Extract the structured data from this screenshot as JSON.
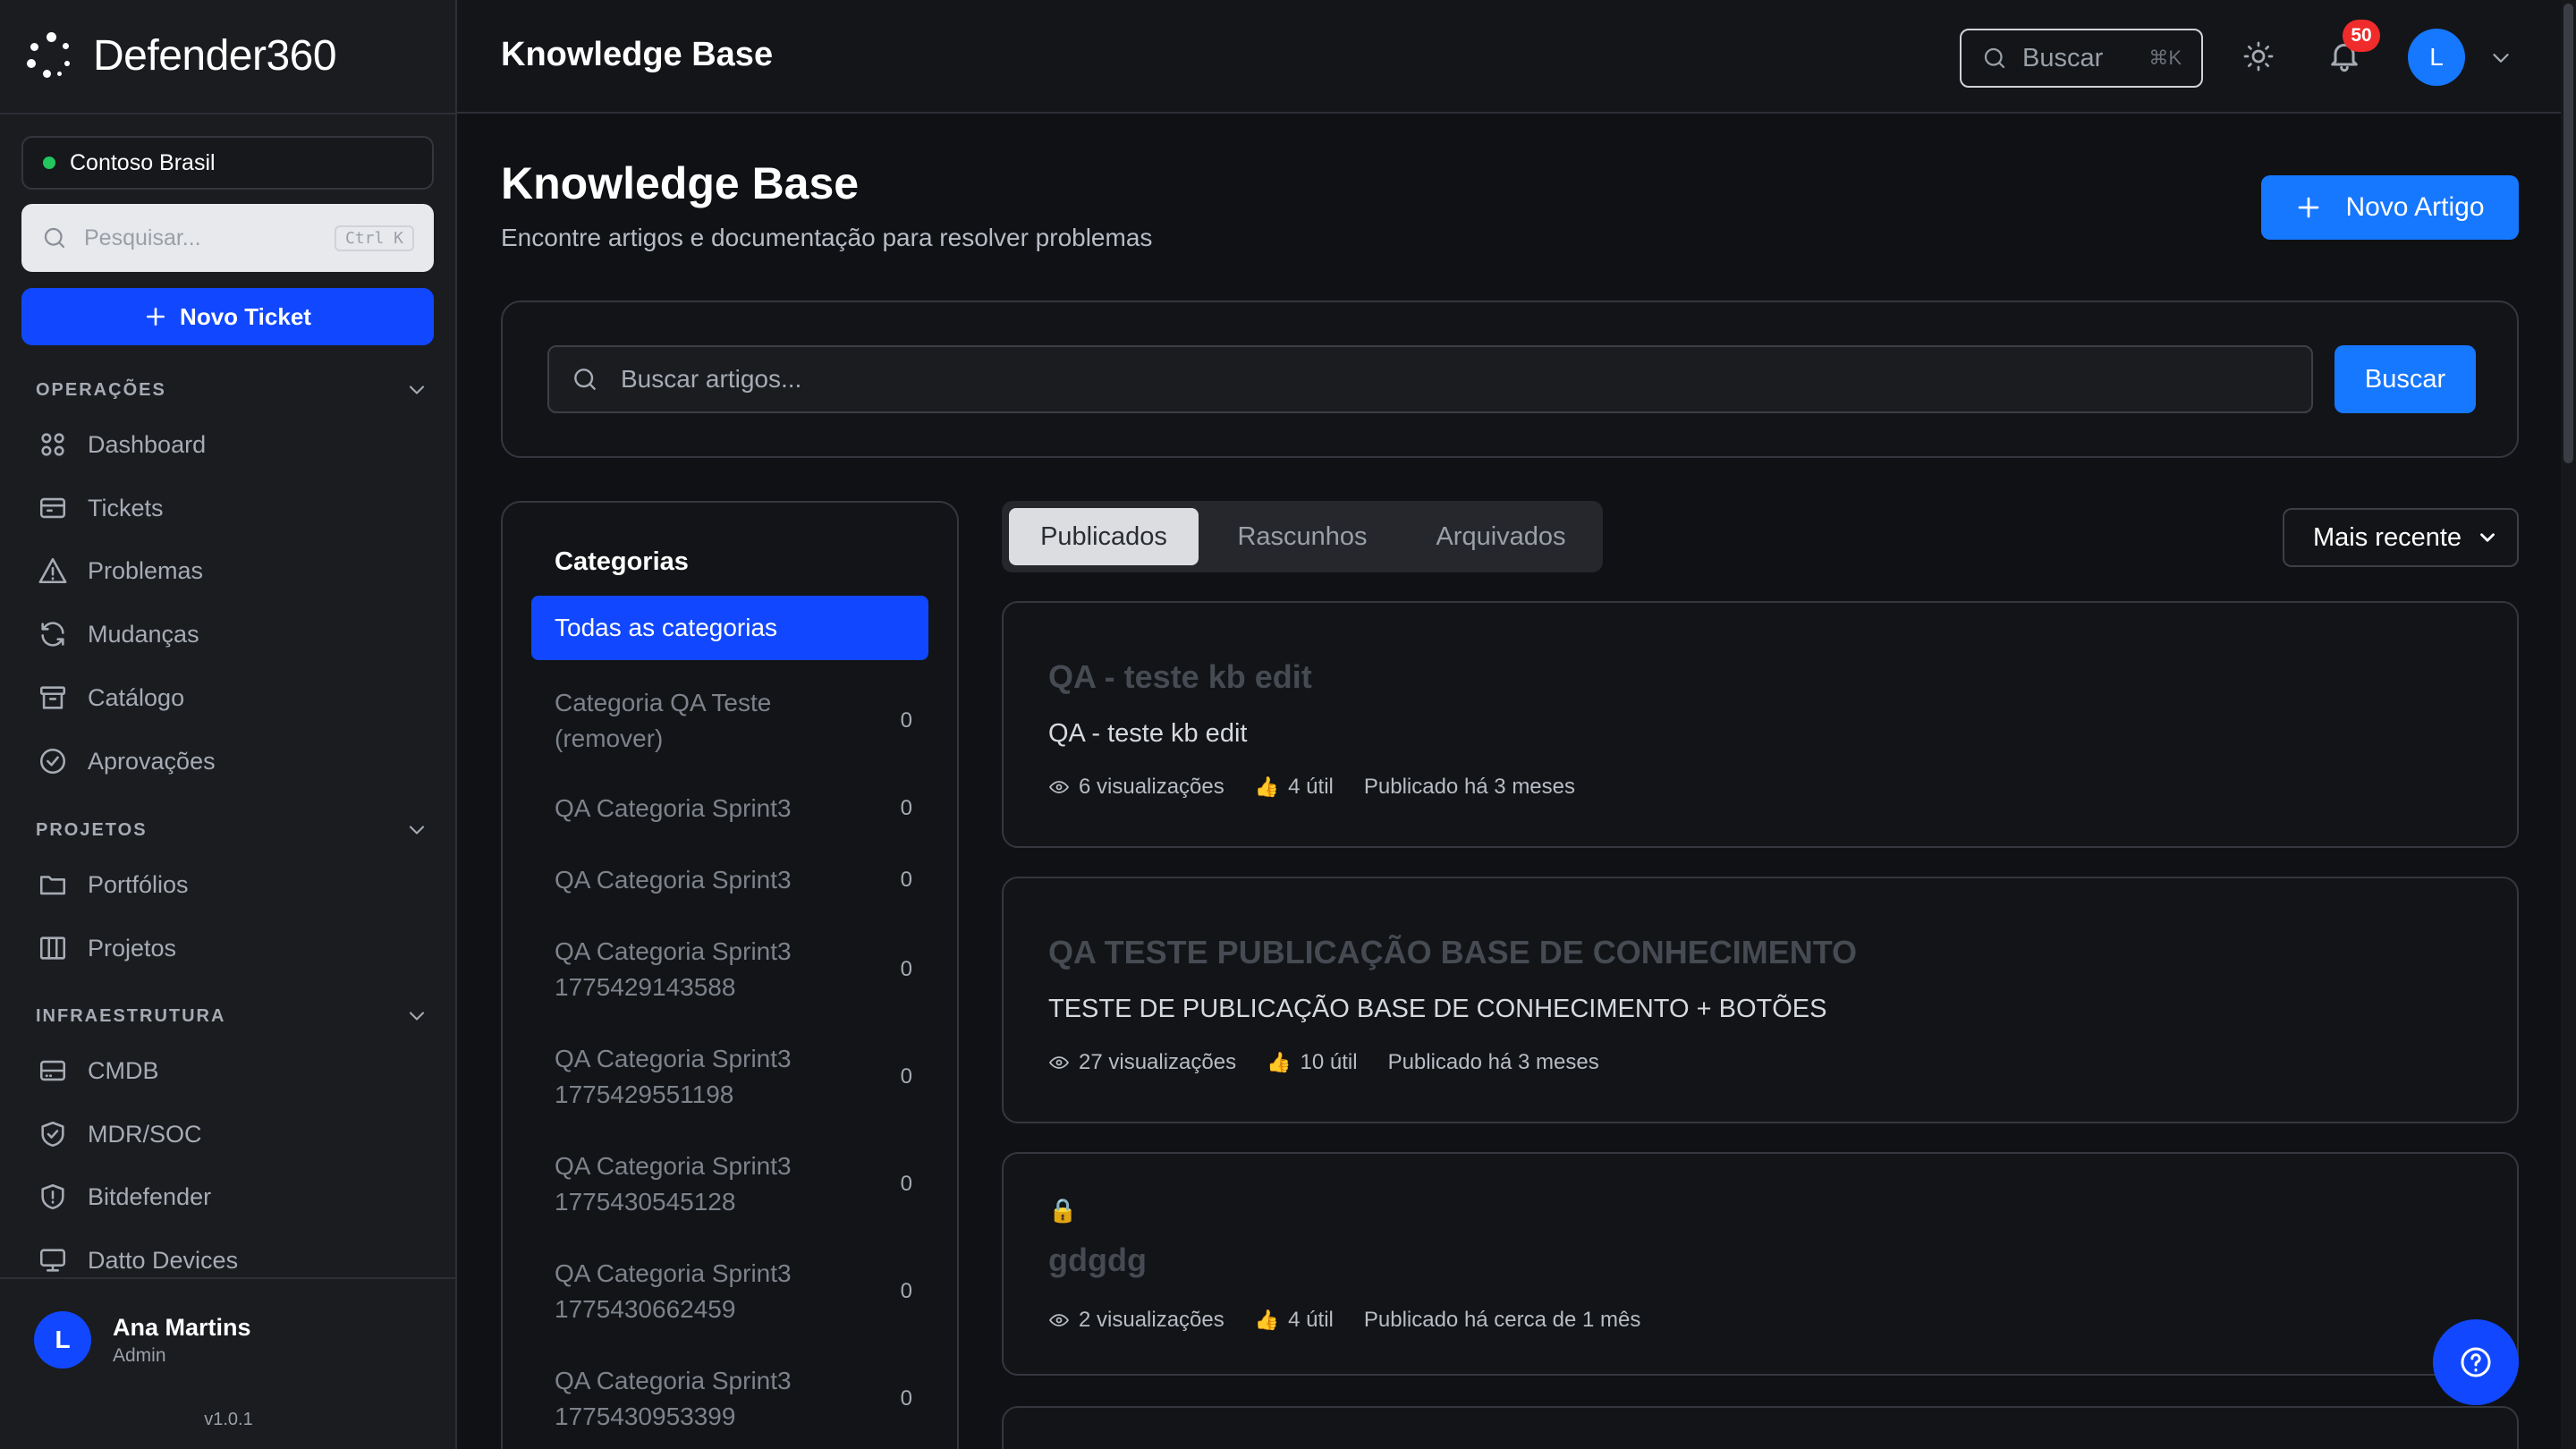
{
  "app": {
    "name": "Defender360"
  },
  "topbar": {
    "title": "Knowledge Base",
    "search_label": "Buscar",
    "search_shortcut": "⌘K",
    "notifications_count": "50",
    "avatar_initial": "L"
  },
  "sidebar": {
    "tenant": "Contoso Brasil",
    "search_placeholder": "Pesquisar...",
    "search_shortcut": "Ctrl K",
    "new_ticket_label": "Novo Ticket",
    "sections": [
      {
        "title": "OPERAÇÕES",
        "items": [
          "Dashboard",
          "Tickets",
          "Problemas",
          "Mudanças",
          "Catálogo",
          "Aprovações"
        ]
      },
      {
        "title": "PROJETOS",
        "items": [
          "Portfólios",
          "Projetos"
        ]
      },
      {
        "title": "INFRAESTRUTURA",
        "items": [
          "CMDB",
          "MDR/SOC",
          "Bitdefender",
          "Datto Devices"
        ]
      }
    ],
    "user": {
      "initial": "L",
      "name": "Ana Martins",
      "role": "Admin"
    },
    "version": "v1.0.1"
  },
  "main": {
    "title": "Knowledge Base",
    "subtitle": "Encontre artigos e documentação para resolver problemas",
    "new_article_label": "Novo Artigo",
    "search_placeholder": "Buscar artigos...",
    "search_button": "Buscar",
    "categories": {
      "title": "Categorias",
      "active": "Todas as categorias",
      "items": [
        {
          "name": "Categoria QA Teste (remover)",
          "count": "0"
        },
        {
          "name": "QA Categoria Sprint3",
          "count": "0"
        },
        {
          "name": "QA Categoria Sprint3",
          "count": "0"
        },
        {
          "name": "QA Categoria Sprint3 1775429143588",
          "count": "0"
        },
        {
          "name": "QA Categoria Sprint3 1775429551198",
          "count": "0"
        },
        {
          "name": "QA Categoria Sprint3 1775430545128",
          "count": "0"
        },
        {
          "name": "QA Categoria Sprint3 1775430662459",
          "count": "0"
        },
        {
          "name": "QA Categoria Sprint3 1775430953399",
          "count": "0"
        }
      ]
    },
    "tabs": [
      "Publicados",
      "Rascunhos",
      "Arquivados"
    ],
    "active_tab": "Publicados",
    "sort_value": "Mais recente",
    "articles": [
      {
        "title": "QA - teste kb edit",
        "excerpt": "QA - teste kb edit",
        "views": "6 visualizações",
        "useful": "4 útil",
        "published": "Publicado há 3 meses"
      },
      {
        "title": "QA TESTE PUBLICAÇÃO BASE DE CONHECIMENTO",
        "excerpt": "TESTE DE PUBLICAÇÃO BASE DE CONHECIMENTO + BOTÕES",
        "views": "27 visualizações",
        "useful": "10 útil",
        "published": "Publicado há 3 meses"
      },
      {
        "title": "gdgdg",
        "lock": "🔒",
        "views": "2 visualizações",
        "useful": "4 útil",
        "published": "Publicado há cerca de 1 mês"
      }
    ]
  },
  "colors": {
    "accent": "#1148ff",
    "primary_button": "#1677ff",
    "badge": "#ef2b2b",
    "status_online": "#22c55e"
  }
}
